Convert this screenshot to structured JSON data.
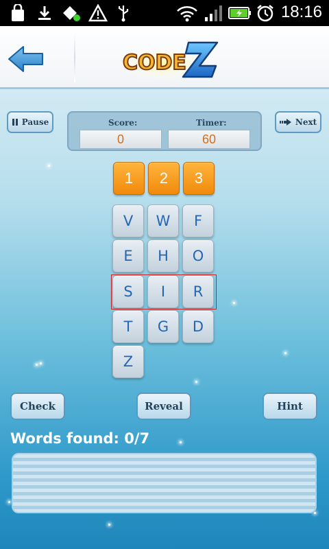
{
  "status_bar": {
    "time": "18:16",
    "icons": [
      "bag-icon",
      "download-icon",
      "debug-icon",
      "warning-icon",
      "usb-icon",
      "wifi-icon",
      "signal-icon",
      "battery-icon",
      "alarm-icon"
    ]
  },
  "header": {
    "back_icon": "back-arrow-icon",
    "logo_text": "CODE-Z"
  },
  "controls": {
    "pause_label": "Pause",
    "next_label": "Next"
  },
  "score": {
    "score_label": "Score:",
    "score_value": "0",
    "timer_label": "Timer:",
    "timer_value": "60"
  },
  "number_tiles": [
    "1",
    "2",
    "3"
  ],
  "letter_grid": {
    "rows": [
      [
        "V",
        "W",
        "F"
      ],
      [
        "E",
        "H",
        "O"
      ],
      [
        "S",
        "I",
        "R"
      ],
      [
        "T",
        "G",
        "D"
      ],
      [
        "Z"
      ]
    ]
  },
  "actions": {
    "check_label": "Check",
    "reveal_label": "Reveal",
    "hint_label": "Hint"
  },
  "words_found_label": "Words found: 0/7",
  "colors": {
    "accent_orange": "#f08a0a",
    "letter_blue": "#2466b4",
    "score_orange": "#d0701a",
    "selection_red": "#c82222"
  }
}
